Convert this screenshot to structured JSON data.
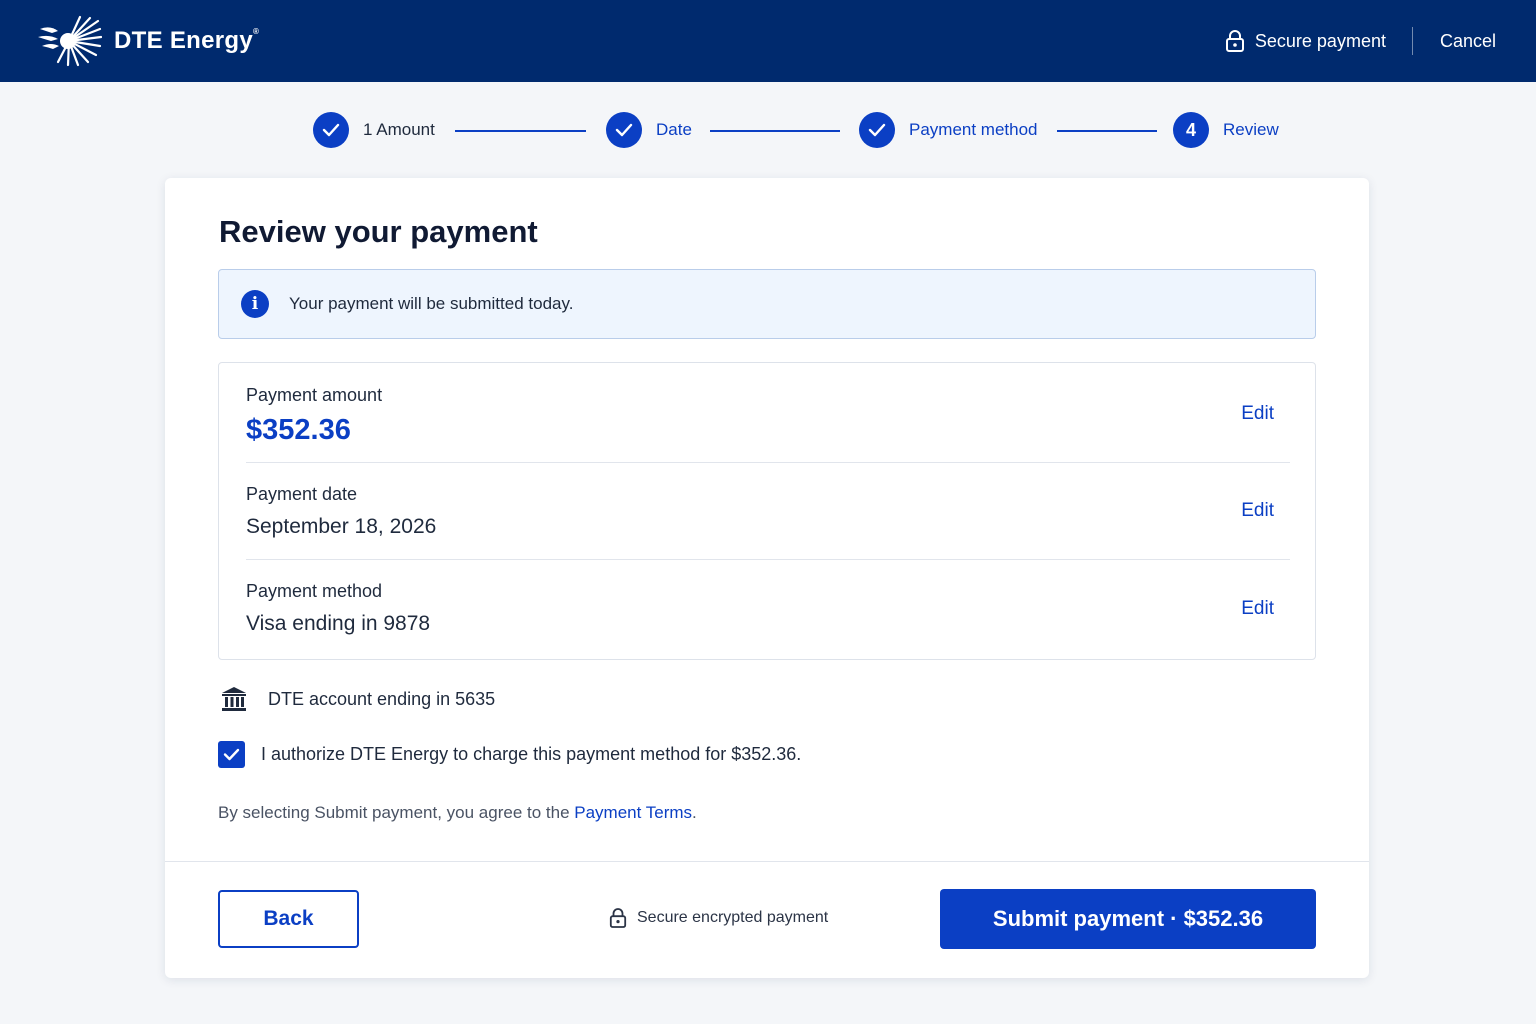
{
  "header": {
    "brand_name": "DTE Energy",
    "brand_mark": "®",
    "secure_label": "Secure payment",
    "cancel_label": "Cancel"
  },
  "stepper": {
    "steps": [
      {
        "label": "1 Amount",
        "status": "complete",
        "icon": "check-icon"
      },
      {
        "label": "Date",
        "status": "complete",
        "icon": "check-icon"
      },
      {
        "label": "Payment method",
        "status": "complete",
        "icon": "check-icon"
      },
      {
        "label": "Review",
        "number": "4",
        "status": "active"
      }
    ]
  },
  "review": {
    "title": "Review your payment",
    "info_icon": "i",
    "info_message": "Your payment will be submitted today.",
    "amount_label": "Payment amount",
    "amount_value": "$352.36",
    "date_label": "Payment date",
    "date_value": "September 18, 2026",
    "method_label": "Payment method",
    "method_value": "Visa ending in 9878",
    "edit_label": "Edit",
    "account_text": "DTE account ending in 5635",
    "authorize_text": "I authorize DTE Energy to charge this payment method for $352.36.",
    "authorize_checked": true,
    "terms_prefix": "By selecting Submit payment, you agree to the ",
    "terms_link": "Payment Terms",
    "terms_suffix": "."
  },
  "footer": {
    "back_label": "Back",
    "secure_note": "Secure encrypted payment",
    "submit_label": "Submit payment · $352.36"
  },
  "colors": {
    "header_bg": "#002a6e",
    "accent": "#0b3fc4",
    "info_bg": "#eef5fe"
  }
}
